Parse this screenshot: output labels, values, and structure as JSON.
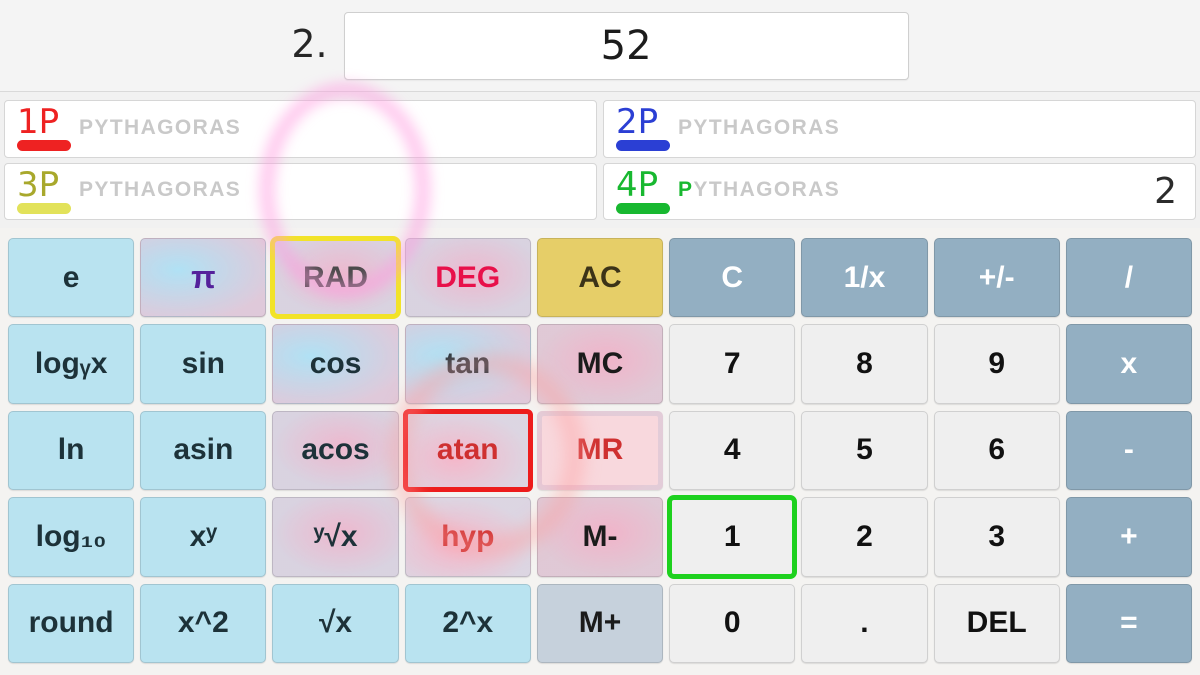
{
  "display": {
    "turn_index": "2.",
    "value": "52",
    "placeholder": ""
  },
  "players": [
    {
      "tag": "1P",
      "color": "#ee2222",
      "word": "PYTHAGORAS",
      "typed": "",
      "remaining": "PYTHAGORAS",
      "score": ""
    },
    {
      "tag": "2P",
      "color": "#2b3fd4",
      "word": "PYTHAGORAS",
      "typed": "",
      "remaining": "PYTHAGORAS",
      "score": ""
    },
    {
      "tag": "3P",
      "color": "#e2e25a",
      "tag_color": "#a8a82c",
      "word": "PYTHAGORAS",
      "typed": "",
      "remaining": "PYTHAGORAS",
      "score": ""
    },
    {
      "tag": "4P",
      "color": "#18b830",
      "word": "PYTHAGORAS",
      "typed": "P",
      "remaining": "YTHAGORAS",
      "score": "2"
    }
  ],
  "keypad": {
    "rows": [
      [
        {
          "label": "e",
          "style": "k-sci"
        },
        {
          "label": "π",
          "style": "k-sci",
          "text_class": "t-pi"
        },
        {
          "label": "RAD",
          "style": "k-sci",
          "text_class": "t-rad",
          "highlight": "yellow"
        },
        {
          "label": "DEG",
          "style": "k-sci",
          "text_class": "t-deg"
        },
        {
          "label": "AC",
          "style": "k-ac"
        },
        {
          "label": "C",
          "style": "k-op"
        },
        {
          "label": "1/x",
          "style": "k-op"
        },
        {
          "label": "+/-",
          "style": "k-op"
        },
        {
          "label": "/",
          "style": "k-op"
        }
      ],
      [
        {
          "label": "logᵧx",
          "style": "k-sci"
        },
        {
          "label": "sin",
          "style": "k-sci"
        },
        {
          "label": "cos",
          "style": "k-sci"
        },
        {
          "label": "tan",
          "style": "k-sci"
        },
        {
          "label": "MC",
          "style": "k-mem"
        },
        {
          "label": "7",
          "style": "k-num"
        },
        {
          "label": "8",
          "style": "k-num"
        },
        {
          "label": "9",
          "style": "k-num"
        },
        {
          "label": "x",
          "style": "k-op"
        }
      ],
      [
        {
          "label": "ln",
          "style": "k-sci"
        },
        {
          "label": "asin",
          "style": "k-sci"
        },
        {
          "label": "acos",
          "style": "k-sci"
        },
        {
          "label": "atan",
          "style": "k-sci",
          "text_class": "t-red",
          "highlight": "red"
        },
        {
          "label": "MR",
          "style": "k-mem",
          "text_class": "t-red",
          "highlight": "magenta-blue"
        },
        {
          "label": "4",
          "style": "k-num"
        },
        {
          "label": "5",
          "style": "k-num"
        },
        {
          "label": "6",
          "style": "k-num"
        },
        {
          "label": "-",
          "style": "k-op"
        }
      ],
      [
        {
          "label": "log₁₀",
          "style": "k-sci"
        },
        {
          "label": "xʸ",
          "style": "k-sci"
        },
        {
          "label": "ʸ√x",
          "style": "k-sci"
        },
        {
          "label": "hyp",
          "style": "k-sci",
          "text_class": "t-red"
        },
        {
          "label": "M-",
          "style": "k-mem"
        },
        {
          "label": "1",
          "style": "k-num",
          "highlight": "green"
        },
        {
          "label": "2",
          "style": "k-num"
        },
        {
          "label": "3",
          "style": "k-num"
        },
        {
          "label": "+",
          "style": "k-op"
        }
      ],
      [
        {
          "label": "round",
          "style": "k-sci"
        },
        {
          "label": "x^2",
          "style": "k-sci"
        },
        {
          "label": "√x",
          "style": "k-sci"
        },
        {
          "label": "2^x",
          "style": "k-sci"
        },
        {
          "label": "M+",
          "style": "k-mem"
        },
        {
          "label": "0",
          "style": "k-num"
        },
        {
          "label": ".",
          "style": "k-num"
        },
        {
          "label": "DEL",
          "style": "k-num"
        },
        {
          "label": "=",
          "style": "k-op"
        }
      ]
    ]
  },
  "colors": {
    "sci_key": "#b9e3f0",
    "ac_key": "#e6ce68",
    "memory_key": "#c6d1dc",
    "number_key": "#efefef",
    "operator_key": "#93afc2",
    "highlight_yellow": "#f2e328",
    "highlight_red": "#ed1c1c",
    "highlight_green": "#1ed11e",
    "highlight_magenta": "#f016e8",
    "highlight_blue": "#1a11cc",
    "annotation_pink": "#ffa8d8"
  }
}
